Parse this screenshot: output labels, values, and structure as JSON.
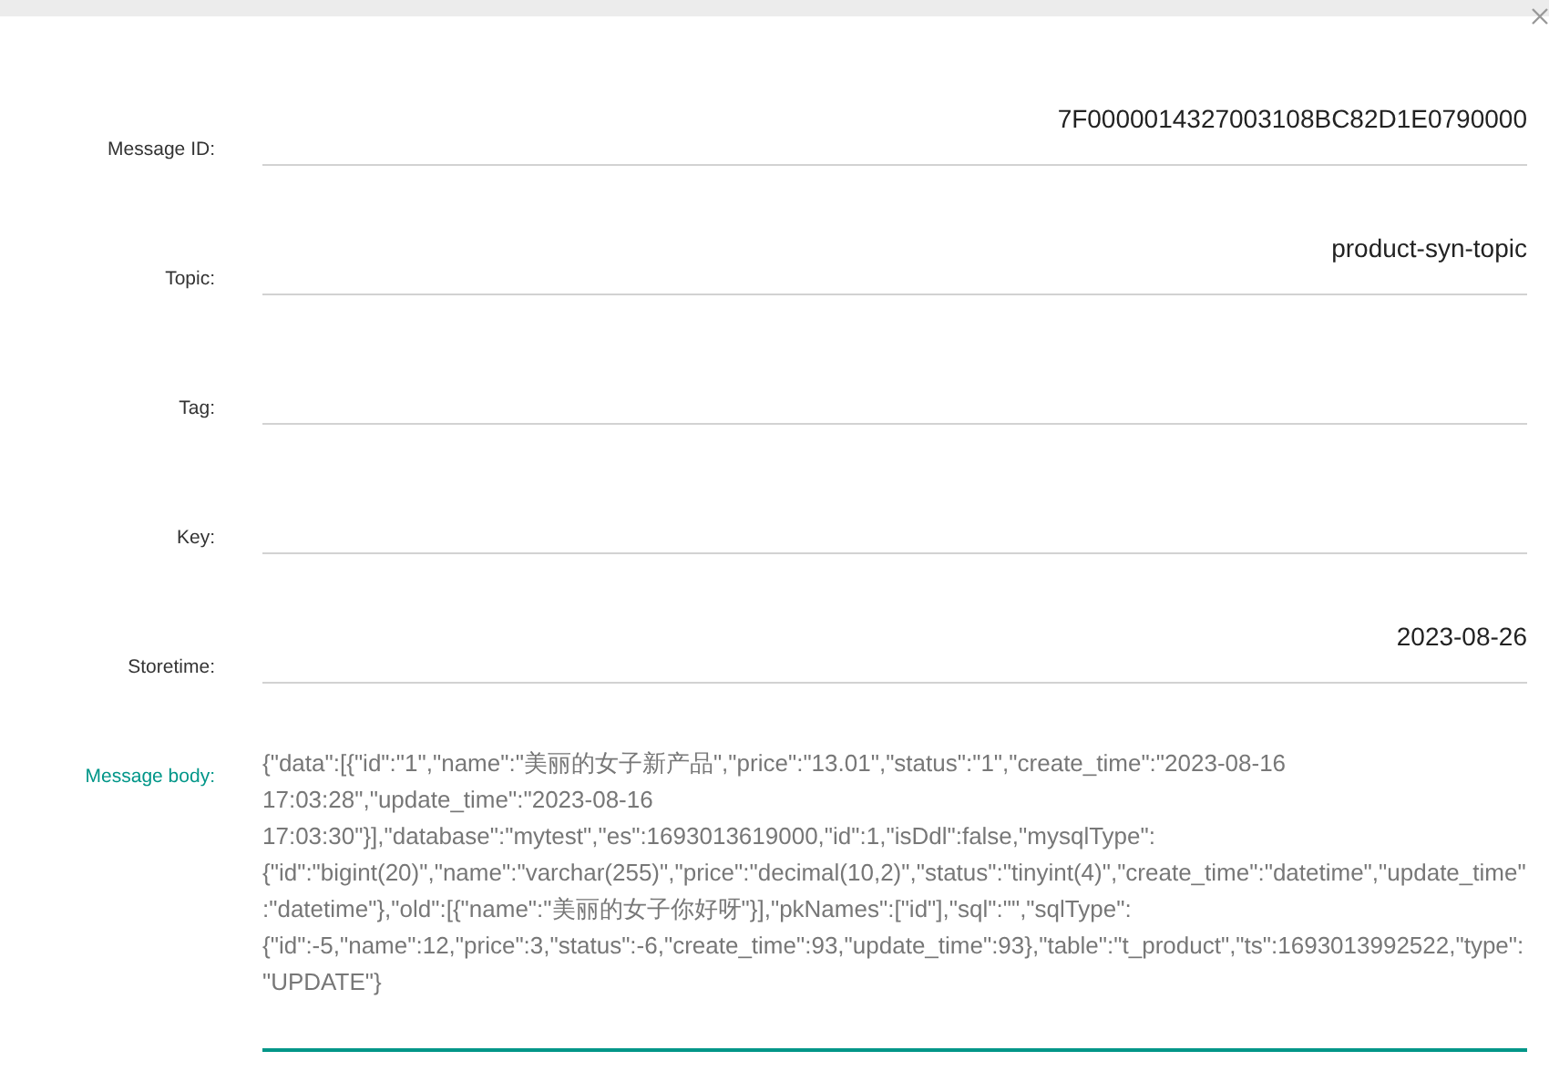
{
  "fields": [
    {
      "label": "Message ID:",
      "value": "7F0000014327003108BC82D1E0790000",
      "focused": false
    },
    {
      "label": "Topic:",
      "value": "product-syn-topic",
      "focused": false
    },
    {
      "label": "Tag:",
      "focused": false
    },
    {
      "label": "Key:",
      "focused": false
    },
    {
      "label": "Storetime:",
      "value": "2023-08-26",
      "focused": false
    }
  ],
  "message_body": {
    "label": "Message body:",
    "focused": true,
    "value": "{\"data\":[{\"id\":\"1\",\"name\":\"美丽的女子新产品\",\"price\":\"13.01\",\"status\":\"1\",\"create_time\":\"2023-08-16 17:03:28\",\"update_time\":\"2023-08-16 17:03:30\"}],\"database\":\"mytest\",\"es\":1693013619000,\"id\":1,\"isDdl\":false,\"mysqlType\":{\"id\":\"bigint(20)\",\"name\":\"varchar(255)\",\"price\":\"decimal(10,2)\",\"status\":\"tinyint(4)\",\"create_time\":\"datetime\",\"update_time\":\"datetime\"},\"old\":[{\"name\":\"美丽的女子你好呀\"}],\"pkNames\":[\"id\"],\"sql\":\"\",\"sqlType\":{\"id\":-5,\"name\":12,\"price\":3,\"status\":-6,\"create_time\":93,\"update_time\":93},\"table\":\"t_product\",\"ts\":1693013992522,\"type\":\"UPDATE\"}"
  }
}
